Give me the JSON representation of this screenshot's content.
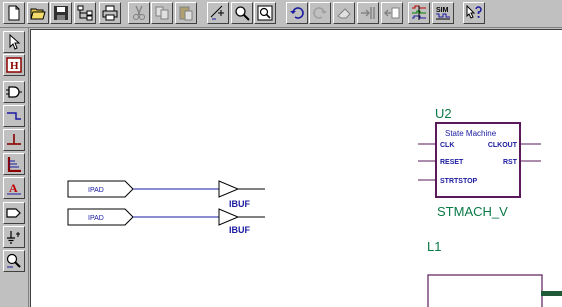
{
  "toolbar": {
    "buttons": [
      {
        "icon": "new-file-icon"
      },
      {
        "icon": "open-folder-icon"
      },
      {
        "icon": "save-disk-icon"
      },
      {
        "icon": "hierarchy-icon"
      },
      {
        "icon": "print-icon"
      },
      {
        "icon": "cut-icon"
      },
      {
        "icon": "copy-icon"
      },
      {
        "icon": "paste-icon"
      },
      {
        "icon": "zoom-area-icon"
      },
      {
        "icon": "zoom-icon"
      },
      {
        "icon": "zoom-fit-icon"
      },
      {
        "icon": "undo-icon"
      },
      {
        "icon": "redo-icon"
      },
      {
        "icon": "eraser-icon"
      },
      {
        "icon": "push-into-icon"
      },
      {
        "icon": "pop-out-icon"
      },
      {
        "icon": "logic-analyzer-icon"
      },
      {
        "icon": "simulator-icon",
        "label": "SIM"
      },
      {
        "icon": "help-cursor-icon"
      }
    ]
  },
  "left_toolbar": {
    "buttons": [
      {
        "icon": "select-arrow-icon"
      },
      {
        "icon": "hierarchy-symbol-icon",
        "label": "H"
      },
      {
        "icon": "component-gate-icon"
      },
      {
        "icon": "wire-icon"
      },
      {
        "icon": "net-label-icon"
      },
      {
        "icon": "bus-icon"
      },
      {
        "icon": "text-icon",
        "label": "A"
      },
      {
        "icon": "io-marker-icon"
      },
      {
        "icon": "power-ground-icon"
      },
      {
        "icon": "query-icon"
      }
    ]
  },
  "schematic": {
    "pads": [
      {
        "label": "IPAD"
      },
      {
        "label": "IPAD"
      }
    ],
    "buffers": [
      {
        "label": "IBUF"
      },
      {
        "label": "IBUF"
      }
    ],
    "state_machine": {
      "ref": "U2",
      "title": "State Machine",
      "name": "STMACH_V",
      "inputs": [
        "CLK",
        "RESET",
        "STRTSTOP"
      ],
      "outputs": [
        "CLKOUT",
        "RST"
      ]
    },
    "l1": {
      "ref": "L1"
    }
  },
  "colors": {
    "ui_gray": "#c0c0c0",
    "symbol_purple": "#5a1a5a",
    "wire_blue": "#1a1aa0",
    "label_green": "#0a7a46"
  }
}
